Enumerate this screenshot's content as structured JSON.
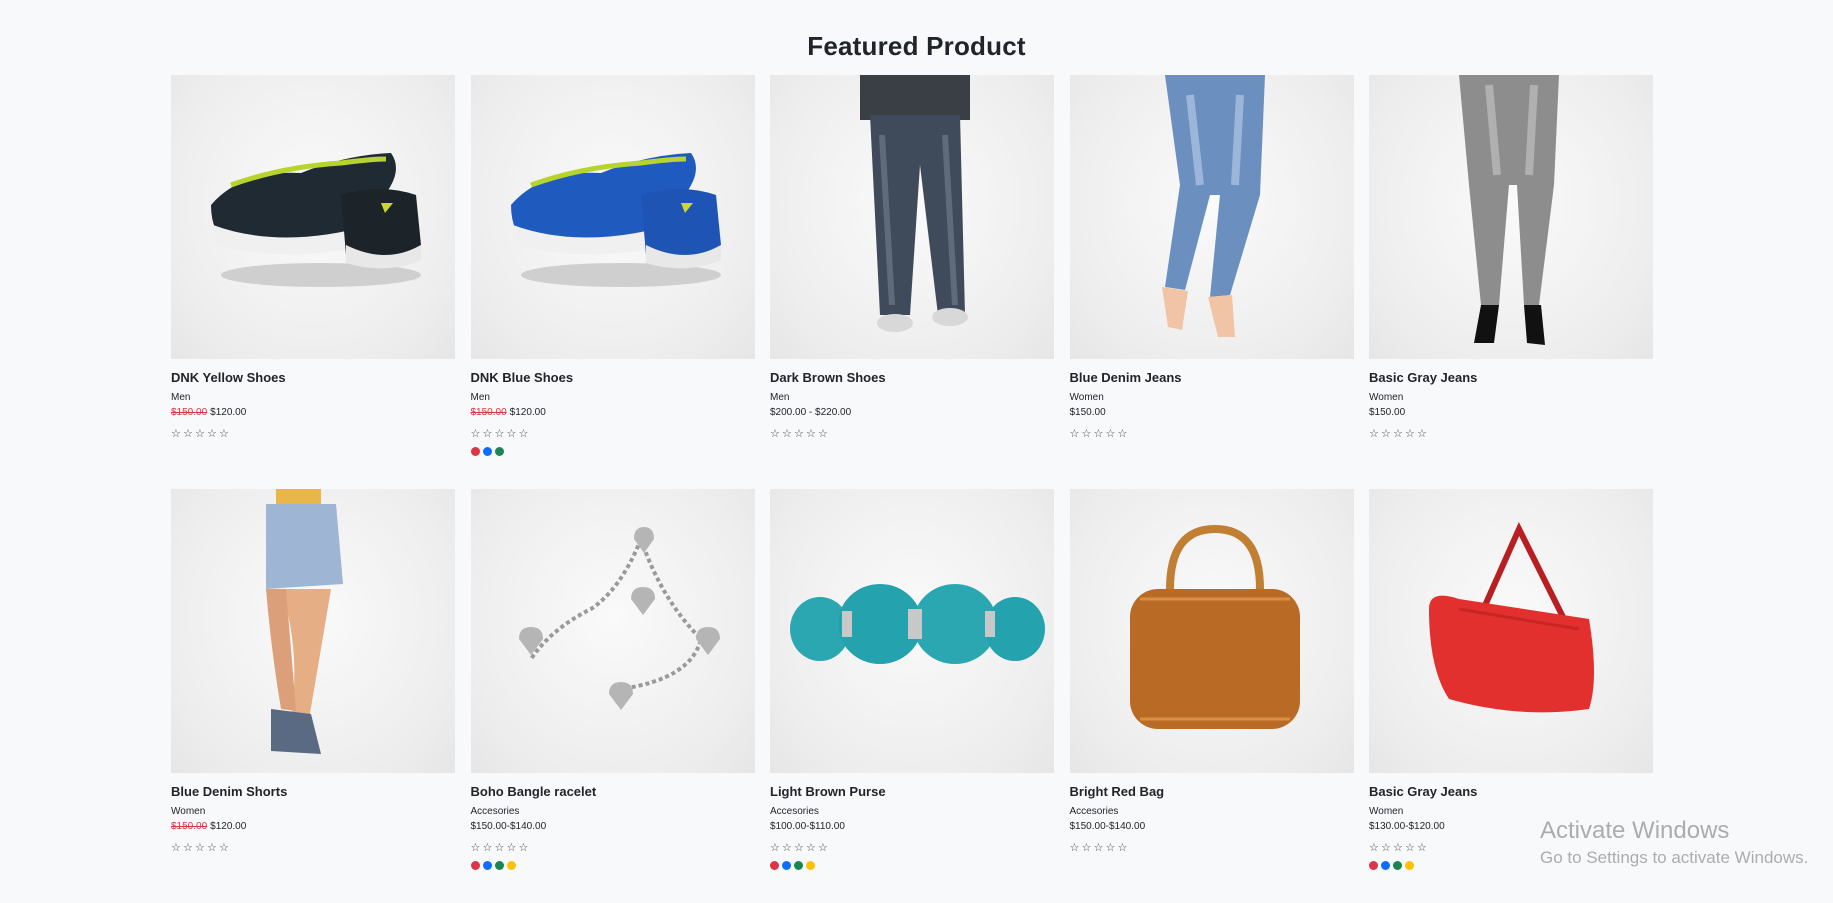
{
  "page_title": "Featured Product",
  "colors": {
    "red": "#dc3545",
    "blue": "#0d6efd",
    "green": "#198754",
    "yellow": "#ffc107"
  },
  "products": [
    {
      "name": "DNK Yellow Shoes",
      "category": "Men",
      "old_price": "$150.00",
      "price": "$120.00",
      "rating": 0,
      "swatches": [],
      "image": "yellow-shoes"
    },
    {
      "name": "DNK Blue Shoes",
      "category": "Men",
      "old_price": "$150.00",
      "price": "$120.00",
      "rating": 0,
      "swatches": [
        "red",
        "blue",
        "green"
      ],
      "image": "blue-shoes"
    },
    {
      "name": "Dark Brown Shoes",
      "category": "Men",
      "old_price": "",
      "price": "$200.00 - $220.00",
      "rating": 0,
      "swatches": [],
      "image": "dark-jeans"
    },
    {
      "name": "Blue Denim Jeans",
      "category": "Women",
      "old_price": "",
      "price": "$150.00",
      "rating": 0,
      "swatches": [],
      "image": "blue-jeans"
    },
    {
      "name": "Basic Gray Jeans",
      "category": "Women",
      "old_price": "",
      "price": "$150.00",
      "rating": 0,
      "swatches": [],
      "image": "gray-jeans"
    },
    {
      "name": "Blue Denim Shorts",
      "category": "Women",
      "old_price": "$150.00",
      "price": "$120.00",
      "rating": 0,
      "swatches": [],
      "image": "denim-shorts"
    },
    {
      "name": "Boho Bangle racelet",
      "category": "Accesories",
      "old_price": "",
      "price": "$150.00-$140.00",
      "rating": 0,
      "swatches": [
        "red",
        "blue",
        "green",
        "yellow"
      ],
      "image": "charm-bracelet"
    },
    {
      "name": "Light Brown Purse",
      "category": "Accesories",
      "old_price": "",
      "price": "$100.00-$110.00",
      "rating": 0,
      "swatches": [
        "red",
        "blue",
        "green",
        "yellow"
      ],
      "image": "turquoise-bracelet"
    },
    {
      "name": "Bright Red Bag",
      "category": "Accesories",
      "old_price": "",
      "price": "$150.00-$140.00",
      "rating": 0,
      "swatches": [],
      "image": "brown-bag"
    },
    {
      "name": "Basic Gray Jeans",
      "category": "Women",
      "old_price": "",
      "price": "$130.00-$120.00",
      "rating": 0,
      "swatches": [
        "red",
        "blue",
        "green",
        "yellow"
      ],
      "image": "red-bag"
    }
  ],
  "watermark": {
    "title": "Activate Windows",
    "subtitle": "Go to Settings to activate Windows."
  }
}
